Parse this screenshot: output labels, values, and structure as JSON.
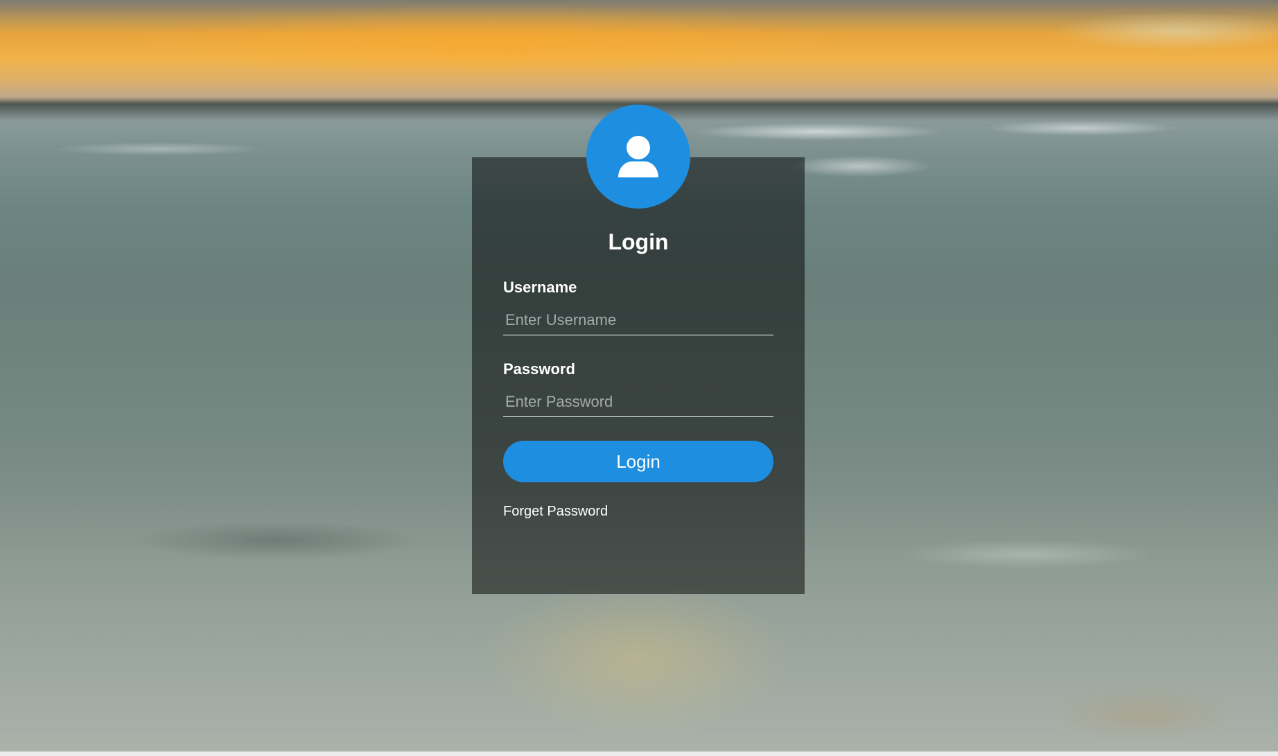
{
  "login": {
    "title": "Login",
    "username_label": "Username",
    "username_placeholder": "Enter Username",
    "username_value": "",
    "password_label": "Password",
    "password_placeholder": "Enter Password",
    "password_value": "",
    "button_label": "Login",
    "forget_link": "Forget Password"
  },
  "icons": {
    "avatar": "user-icon"
  },
  "colors": {
    "accent": "#1e8ee0",
    "panel_overlay": "rgba(0,0,0,0.5)",
    "text": "#ffffff"
  }
}
